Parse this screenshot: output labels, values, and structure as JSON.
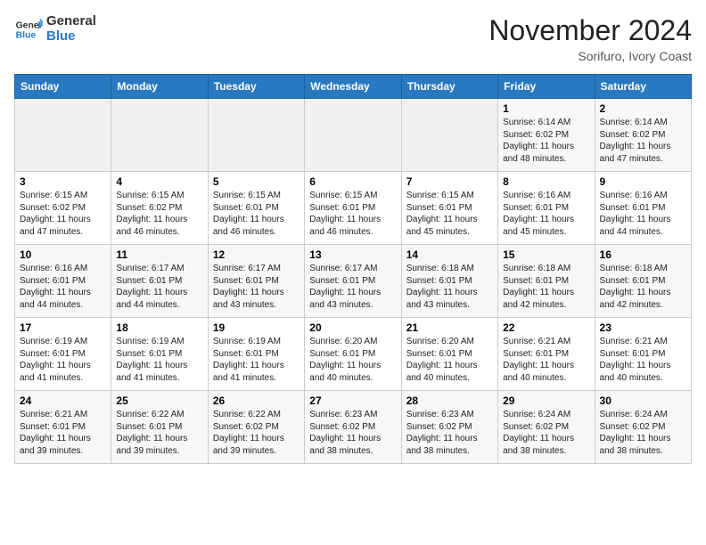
{
  "header": {
    "logo_line1": "General",
    "logo_line2": "Blue",
    "month": "November 2024",
    "location": "Sorifuro, Ivory Coast"
  },
  "weekdays": [
    "Sunday",
    "Monday",
    "Tuesday",
    "Wednesday",
    "Thursday",
    "Friday",
    "Saturday"
  ],
  "weeks": [
    [
      {
        "day": "",
        "info": ""
      },
      {
        "day": "",
        "info": ""
      },
      {
        "day": "",
        "info": ""
      },
      {
        "day": "",
        "info": ""
      },
      {
        "day": "",
        "info": ""
      },
      {
        "day": "1",
        "info": "Sunrise: 6:14 AM\nSunset: 6:02 PM\nDaylight: 11 hours\nand 48 minutes."
      },
      {
        "day": "2",
        "info": "Sunrise: 6:14 AM\nSunset: 6:02 PM\nDaylight: 11 hours\nand 47 minutes."
      }
    ],
    [
      {
        "day": "3",
        "info": "Sunrise: 6:15 AM\nSunset: 6:02 PM\nDaylight: 11 hours\nand 47 minutes."
      },
      {
        "day": "4",
        "info": "Sunrise: 6:15 AM\nSunset: 6:02 PM\nDaylight: 11 hours\nand 46 minutes."
      },
      {
        "day": "5",
        "info": "Sunrise: 6:15 AM\nSunset: 6:01 PM\nDaylight: 11 hours\nand 46 minutes."
      },
      {
        "day": "6",
        "info": "Sunrise: 6:15 AM\nSunset: 6:01 PM\nDaylight: 11 hours\nand 46 minutes."
      },
      {
        "day": "7",
        "info": "Sunrise: 6:15 AM\nSunset: 6:01 PM\nDaylight: 11 hours\nand 45 minutes."
      },
      {
        "day": "8",
        "info": "Sunrise: 6:16 AM\nSunset: 6:01 PM\nDaylight: 11 hours\nand 45 minutes."
      },
      {
        "day": "9",
        "info": "Sunrise: 6:16 AM\nSunset: 6:01 PM\nDaylight: 11 hours\nand 44 minutes."
      }
    ],
    [
      {
        "day": "10",
        "info": "Sunrise: 6:16 AM\nSunset: 6:01 PM\nDaylight: 11 hours\nand 44 minutes."
      },
      {
        "day": "11",
        "info": "Sunrise: 6:17 AM\nSunset: 6:01 PM\nDaylight: 11 hours\nand 44 minutes."
      },
      {
        "day": "12",
        "info": "Sunrise: 6:17 AM\nSunset: 6:01 PM\nDaylight: 11 hours\nand 43 minutes."
      },
      {
        "day": "13",
        "info": "Sunrise: 6:17 AM\nSunset: 6:01 PM\nDaylight: 11 hours\nand 43 minutes."
      },
      {
        "day": "14",
        "info": "Sunrise: 6:18 AM\nSunset: 6:01 PM\nDaylight: 11 hours\nand 43 minutes."
      },
      {
        "day": "15",
        "info": "Sunrise: 6:18 AM\nSunset: 6:01 PM\nDaylight: 11 hours\nand 42 minutes."
      },
      {
        "day": "16",
        "info": "Sunrise: 6:18 AM\nSunset: 6:01 PM\nDaylight: 11 hours\nand 42 minutes."
      }
    ],
    [
      {
        "day": "17",
        "info": "Sunrise: 6:19 AM\nSunset: 6:01 PM\nDaylight: 11 hours\nand 41 minutes."
      },
      {
        "day": "18",
        "info": "Sunrise: 6:19 AM\nSunset: 6:01 PM\nDaylight: 11 hours\nand 41 minutes."
      },
      {
        "day": "19",
        "info": "Sunrise: 6:19 AM\nSunset: 6:01 PM\nDaylight: 11 hours\nand 41 minutes."
      },
      {
        "day": "20",
        "info": "Sunrise: 6:20 AM\nSunset: 6:01 PM\nDaylight: 11 hours\nand 40 minutes."
      },
      {
        "day": "21",
        "info": "Sunrise: 6:20 AM\nSunset: 6:01 PM\nDaylight: 11 hours\nand 40 minutes."
      },
      {
        "day": "22",
        "info": "Sunrise: 6:21 AM\nSunset: 6:01 PM\nDaylight: 11 hours\nand 40 minutes."
      },
      {
        "day": "23",
        "info": "Sunrise: 6:21 AM\nSunset: 6:01 PM\nDaylight: 11 hours\nand 40 minutes."
      }
    ],
    [
      {
        "day": "24",
        "info": "Sunrise: 6:21 AM\nSunset: 6:01 PM\nDaylight: 11 hours\nand 39 minutes."
      },
      {
        "day": "25",
        "info": "Sunrise: 6:22 AM\nSunset: 6:01 PM\nDaylight: 11 hours\nand 39 minutes."
      },
      {
        "day": "26",
        "info": "Sunrise: 6:22 AM\nSunset: 6:02 PM\nDaylight: 11 hours\nand 39 minutes."
      },
      {
        "day": "27",
        "info": "Sunrise: 6:23 AM\nSunset: 6:02 PM\nDaylight: 11 hours\nand 38 minutes."
      },
      {
        "day": "28",
        "info": "Sunrise: 6:23 AM\nSunset: 6:02 PM\nDaylight: 11 hours\nand 38 minutes."
      },
      {
        "day": "29",
        "info": "Sunrise: 6:24 AM\nSunset: 6:02 PM\nDaylight: 11 hours\nand 38 minutes."
      },
      {
        "day": "30",
        "info": "Sunrise: 6:24 AM\nSunset: 6:02 PM\nDaylight: 11 hours\nand 38 minutes."
      }
    ]
  ]
}
